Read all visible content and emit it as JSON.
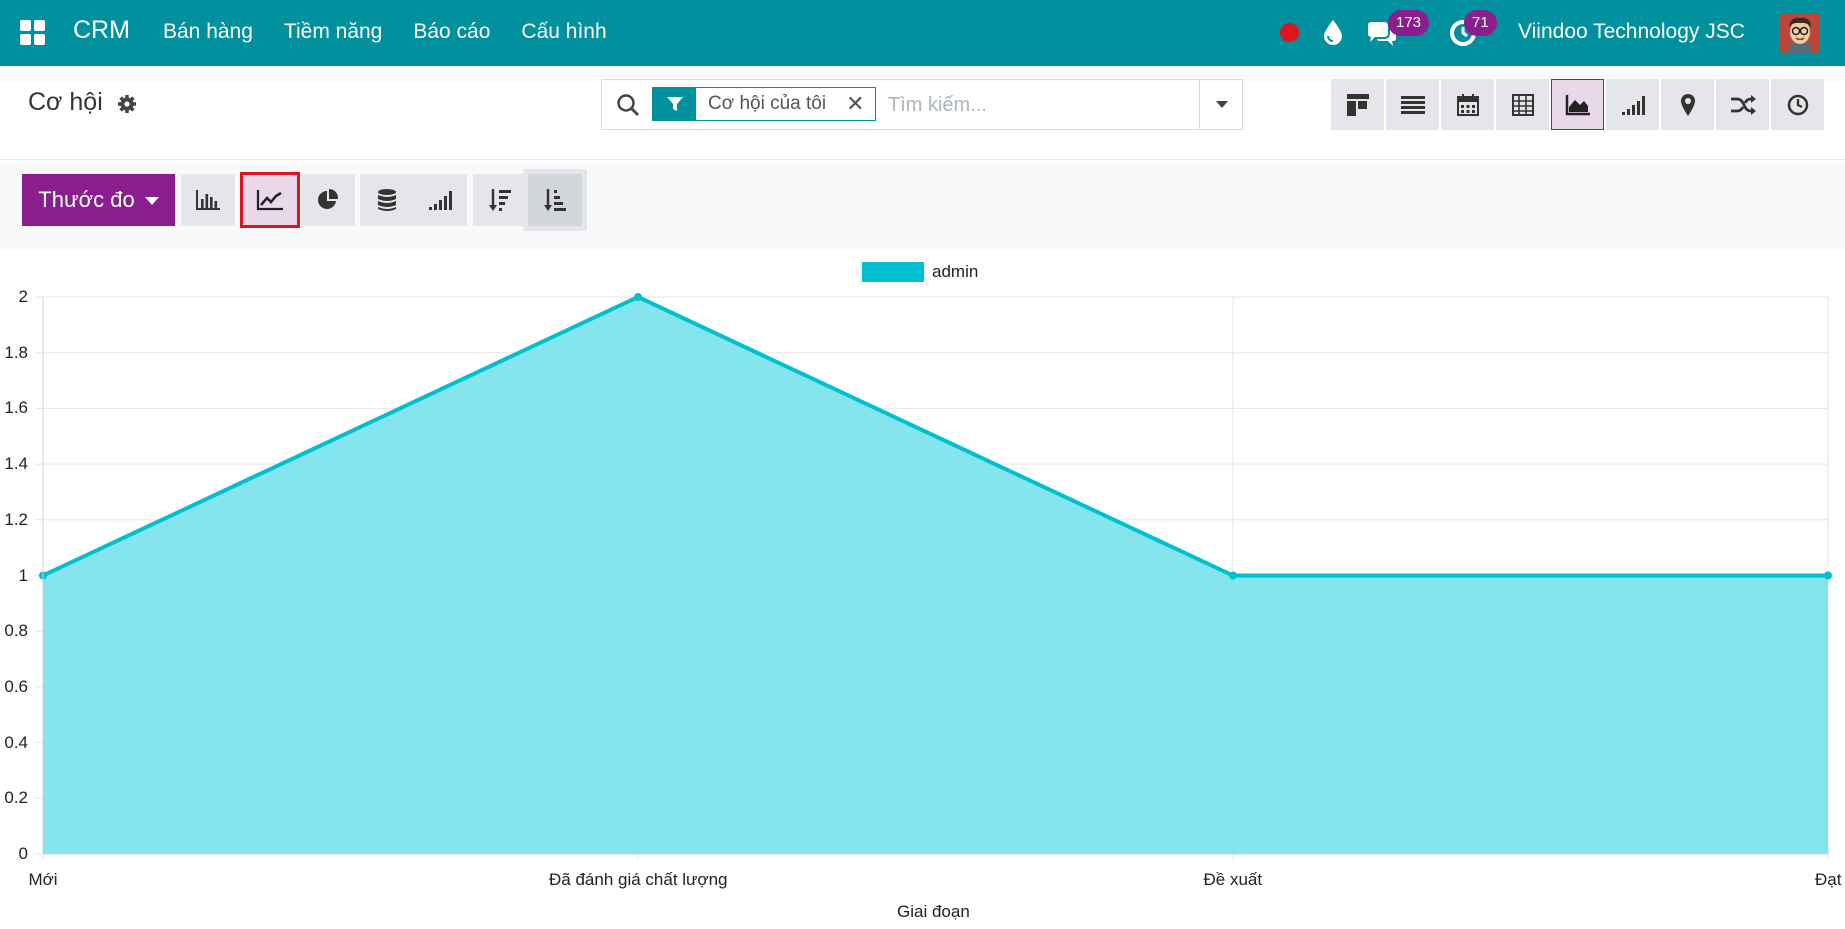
{
  "navbar": {
    "brand": "CRM",
    "menu": [
      "Bán hàng",
      "Tiềm năng",
      "Báo cáo",
      "Cấu hình"
    ],
    "messages_count": "173",
    "activities_count": "71",
    "company": "Viindoo Technology JSC"
  },
  "control": {
    "title": "Cơ hội",
    "facet": "Cơ hội của tôi",
    "search_placeholder": "Tìm kiếm..."
  },
  "graph_toolbar": {
    "measure_label": "Thước đo"
  },
  "colors": {
    "navbar": "#01909d",
    "accent": "#8b1e8f",
    "series_line": "#00bfd0",
    "series_fill": "#7de4ec"
  },
  "chart_data": {
    "type": "area",
    "categories": [
      "Mới",
      "Đã đánh giá chất lượng",
      "Đề xuất",
      "Đạt"
    ],
    "series": [
      {
        "name": "admin",
        "values": [
          1,
          2,
          1,
          1
        ]
      }
    ],
    "xlabel": "Giai đoạn",
    "ylabel": "",
    "ylim": [
      0,
      2
    ],
    "yticks": [
      "2",
      "1.8",
      "1.6",
      "1.4",
      "1.2",
      "1",
      "0.8",
      "0.6",
      "0.4",
      "0.2",
      "0"
    ],
    "grid": true,
    "legend": "top-center"
  }
}
